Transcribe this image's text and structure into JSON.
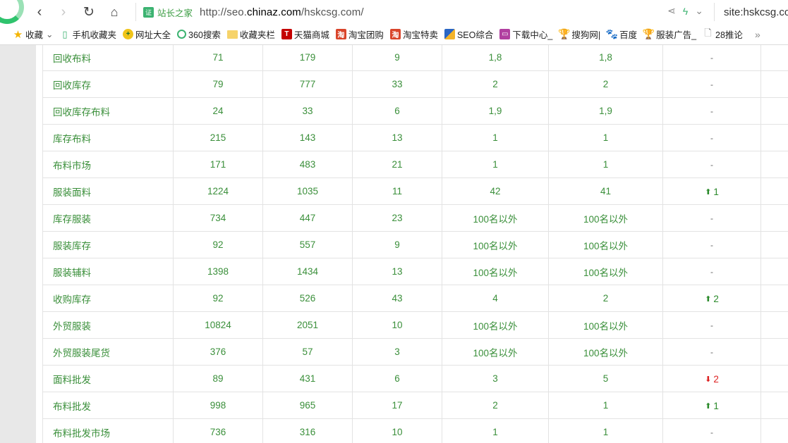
{
  "browser": {
    "site_name": "站长之家",
    "url_prefix": "http://seo.",
    "url_domain": "chinaz.com",
    "url_suffix": "/hskcsg.com/",
    "search_text": "site:hskcsg.com"
  },
  "bookmarks": [
    {
      "label": "收藏",
      "icon": "star-icon",
      "glyph": "★",
      "cls": "star",
      "caret": "⌄"
    },
    {
      "label": "手机收藏夹",
      "icon": "phone-icon",
      "glyph": "▯",
      "cls": "phone"
    },
    {
      "label": "网址大全",
      "icon": "plus-icon",
      "glyph": "+",
      "cls": "plus"
    },
    {
      "label": "360搜索",
      "icon": "ring-icon",
      "glyph": "",
      "cls": "ring"
    },
    {
      "label": "收藏夹栏",
      "icon": "folder-icon",
      "glyph": "",
      "cls": "folder"
    },
    {
      "label": "天猫商城",
      "icon": "tmall-icon",
      "glyph": "T",
      "cls": "tmall"
    },
    {
      "label": "淘宝团购",
      "icon": "taobao-icon",
      "glyph": "淘",
      "cls": "tao"
    },
    {
      "label": "淘宝特卖",
      "icon": "taobao-icon",
      "glyph": "淘",
      "cls": "tao"
    },
    {
      "label": "SEO综合",
      "icon": "seo-icon",
      "glyph": "",
      "cls": "seo"
    },
    {
      "label": "下载中心_",
      "icon": "download-icon",
      "glyph": "▭",
      "cls": "dl"
    },
    {
      "label": "搜狗网|",
      "icon": "trophy-icon",
      "glyph": "🏆",
      "cls": "trophy"
    },
    {
      "label": "百度",
      "icon": "paw-icon",
      "glyph": "🐾",
      "cls": "paw"
    },
    {
      "label": "服装广告_",
      "icon": "trophy-icon",
      "glyph": "🏆",
      "cls": "trophy"
    },
    {
      "label": "28推论",
      "icon": "document-icon",
      "glyph": "🗋",
      "cls": "doc"
    }
  ],
  "bookmarks_more": "»",
  "table": {
    "rows": [
      {
        "keyword": "回收布料",
        "c1": "71",
        "c2": "179",
        "c3": "9",
        "c4": "1,8",
        "c5": "1,8",
        "change": "-",
        "dir": ""
      },
      {
        "keyword": "回收库存",
        "c1": "79",
        "c2": "777",
        "c3": "33",
        "c4": "2",
        "c5": "2",
        "change": "-",
        "dir": ""
      },
      {
        "keyword": "回收库存布料",
        "c1": "24",
        "c2": "33",
        "c3": "6",
        "c4": "1,9",
        "c5": "1,9",
        "change": "-",
        "dir": ""
      },
      {
        "keyword": "库存布料",
        "c1": "215",
        "c2": "143",
        "c3": "13",
        "c4": "1",
        "c5": "1",
        "change": "-",
        "dir": ""
      },
      {
        "keyword": "布料市场",
        "c1": "171",
        "c2": "483",
        "c3": "21",
        "c4": "1",
        "c5": "1",
        "change": "-",
        "dir": ""
      },
      {
        "keyword": "服装面料",
        "c1": "1224",
        "c2": "1035",
        "c3": "11",
        "c4": "42",
        "c5": "41",
        "change": "1",
        "dir": "up"
      },
      {
        "keyword": "库存服装",
        "c1": "734",
        "c2": "447",
        "c3": "23",
        "c4": "100名以外",
        "c5": "100名以外",
        "change": "-",
        "dir": ""
      },
      {
        "keyword": "服装库存",
        "c1": "92",
        "c2": "557",
        "c3": "9",
        "c4": "100名以外",
        "c5": "100名以外",
        "change": "-",
        "dir": ""
      },
      {
        "keyword": "服装辅料",
        "c1": "1398",
        "c2": "1434",
        "c3": "13",
        "c4": "100名以外",
        "c5": "100名以外",
        "change": "-",
        "dir": ""
      },
      {
        "keyword": "收购库存",
        "c1": "92",
        "c2": "526",
        "c3": "43",
        "c4": "4",
        "c5": "2",
        "change": "2",
        "dir": "up"
      },
      {
        "keyword": "外贸服装",
        "c1": "10824",
        "c2": "2051",
        "c3": "10",
        "c4": "100名以外",
        "c5": "100名以外",
        "change": "-",
        "dir": ""
      },
      {
        "keyword": "外贸服装尾货",
        "c1": "376",
        "c2": "57",
        "c3": "3",
        "c4": "100名以外",
        "c5": "100名以外",
        "change": "-",
        "dir": ""
      },
      {
        "keyword": "面料批发",
        "c1": "89",
        "c2": "431",
        "c3": "6",
        "c4": "3",
        "c5": "5",
        "change": "2",
        "dir": "down"
      },
      {
        "keyword": "布料批发",
        "c1": "998",
        "c2": "965",
        "c3": "17",
        "c4": "2",
        "c5": "1",
        "change": "1",
        "dir": "up"
      },
      {
        "keyword": "布料批发市场",
        "c1": "736",
        "c2": "316",
        "c3": "10",
        "c4": "1",
        "c5": "1",
        "change": "-",
        "dir": ""
      }
    ]
  }
}
